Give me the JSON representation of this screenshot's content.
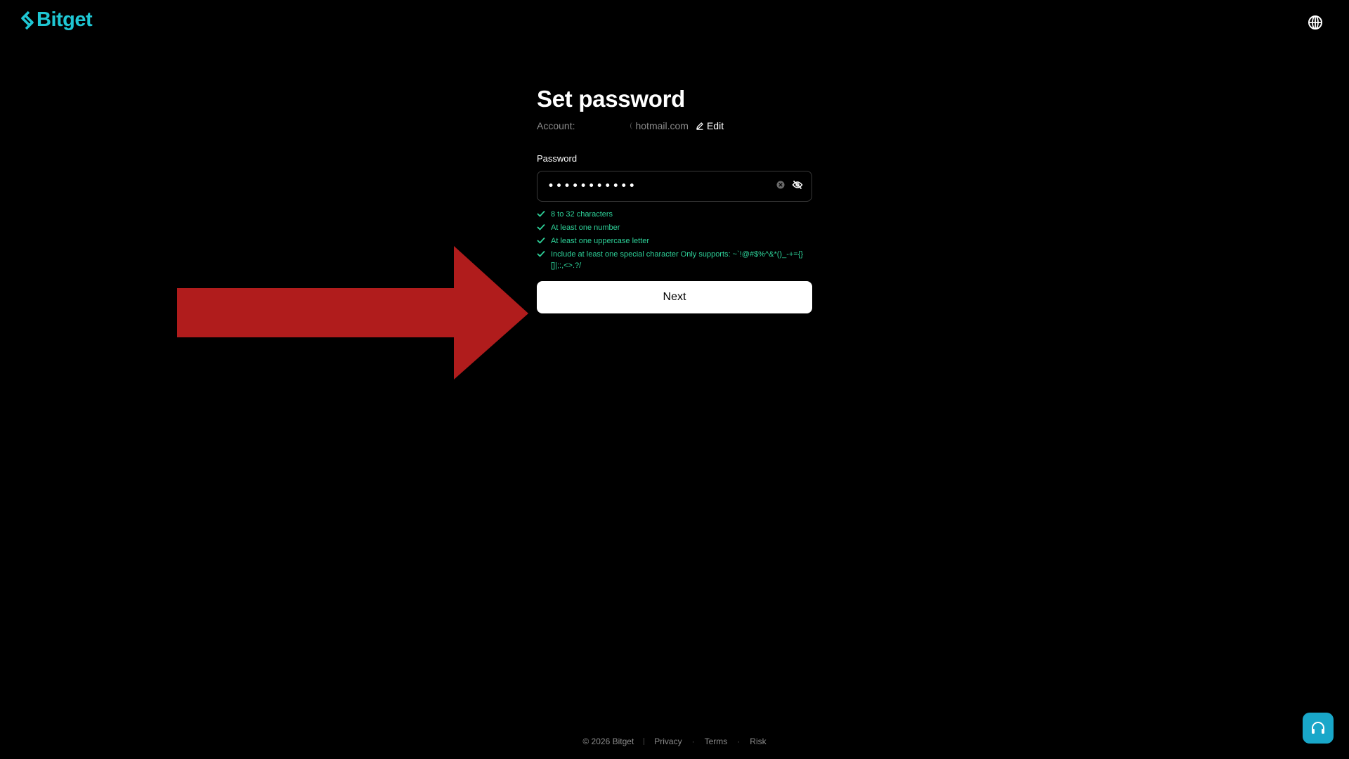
{
  "header": {
    "brand": "Bitget",
    "brand_color": "#1fc7d4",
    "language_icon": "globe-icon"
  },
  "form": {
    "title": "Set password",
    "account_label": "Account:",
    "account_domain": "hotmail.com",
    "edit_label": "Edit",
    "password_label": "Password",
    "password_value": "•••••••••••",
    "rules": [
      "8 to 32 characters",
      "At least one number",
      "At least one uppercase letter",
      "Include at least one special character Only supports: ~`!@#$%^&*()_-+={}[]|;:,<>.?/"
    ],
    "rule_color": "#2ed39a",
    "next_label": "Next"
  },
  "annotation": {
    "arrow_color": "#b01c1c"
  },
  "footer": {
    "copyright": "© 2026 Bitget",
    "links": [
      "Privacy",
      "Terms",
      "Risk"
    ]
  },
  "support": {
    "icon": "headset-icon",
    "color": "#19a7c9"
  }
}
